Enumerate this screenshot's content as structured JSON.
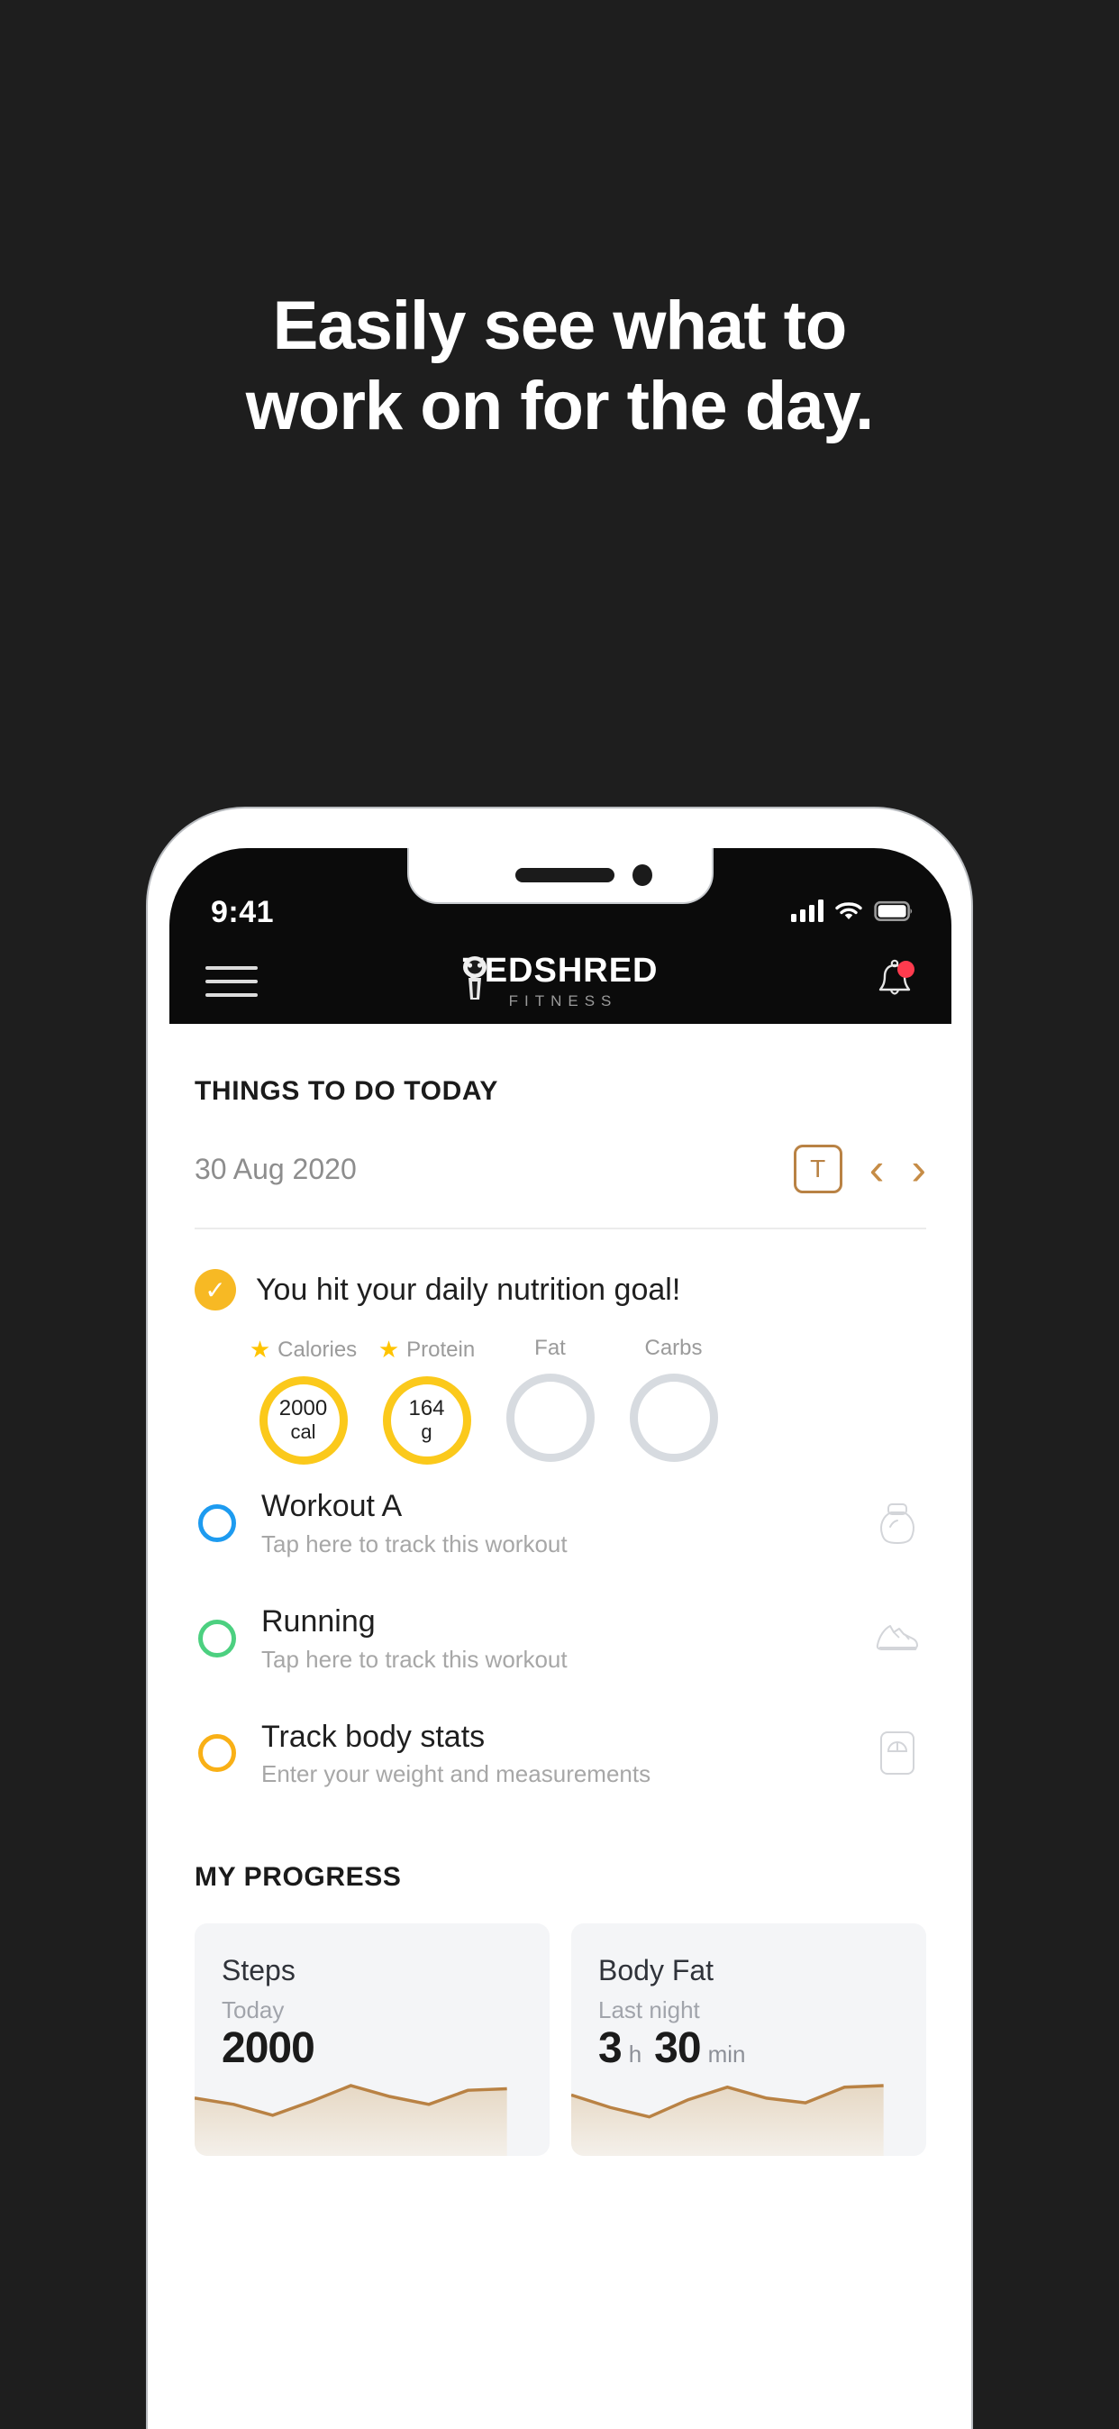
{
  "promo": {
    "line1": "Easily see what to",
    "line2": "work on for the day."
  },
  "status_bar": {
    "time": "9:41",
    "signal_icon": "cellular-signal-icon",
    "wifi_icon": "wifi-icon",
    "battery_icon": "battery-full-icon"
  },
  "app_bar": {
    "menu_icon": "hamburger-menu-icon",
    "brand_name": "TEDSHRED",
    "brand_tagline": "FITNESS",
    "mascot_icon": "mascot-logo-icon",
    "notifications_icon": "bell-icon",
    "notification_badge": true
  },
  "things_to_do": {
    "section_title": "THINGS TO DO TODAY",
    "date": "30 Aug 2020",
    "today_button_label": "T",
    "prev_icon": "chevron-left-icon",
    "next_icon": "chevron-right-icon"
  },
  "nutrition": {
    "check_icon": "checkmark-icon",
    "message": "You hit your daily nutrition goal!",
    "macros": [
      {
        "label": "Calories",
        "starred": true,
        "value": "2000",
        "unit": "cal",
        "complete": true
      },
      {
        "label": "Protein",
        "starred": true,
        "value": "164",
        "unit": "g",
        "complete": true
      },
      {
        "label": "Fat",
        "starred": false,
        "value": "",
        "unit": "",
        "complete": false
      },
      {
        "label": "Carbs",
        "starred": false,
        "value": "",
        "unit": "",
        "complete": false
      }
    ]
  },
  "tasks": [
    {
      "title": "Workout A",
      "subtitle": "Tap here to track this workout",
      "ring_color": "#1d9bf0",
      "icon": "kettlebell-icon"
    },
    {
      "title": "Running",
      "subtitle": "Tap here to track this workout",
      "ring_color": "#4cd080",
      "icon": "running-shoe-icon"
    },
    {
      "title": "Track body stats",
      "subtitle": "Enter your weight and measurements",
      "ring_color": "#f9b016",
      "icon": "weight-scale-icon"
    }
  ],
  "my_progress": {
    "section_title": "MY PROGRESS",
    "cards": [
      {
        "title": "Steps",
        "period": "Today",
        "value": "2000",
        "unit": "",
        "value2": "",
        "unit2": ""
      },
      {
        "title": "Body Fat",
        "period": "Last night",
        "value": "3",
        "unit": "h",
        "value2": "30",
        "unit2": "min"
      }
    ]
  },
  "chart_data": [
    {
      "type": "area",
      "title": "Steps",
      "x": [
        0,
        1,
        2,
        3,
        4,
        5,
        6,
        7,
        8
      ],
      "values": [
        62,
        56,
        44,
        58,
        74,
        64,
        58,
        70,
        72
      ],
      "ylim": [
        0,
        100
      ],
      "xlabel": "",
      "ylabel": "",
      "grid": false,
      "legend": "none",
      "line_color": "#b98244",
      "fill_color": "#ece3d6"
    },
    {
      "type": "area",
      "title": "Body Fat",
      "x": [
        0,
        1,
        2,
        3,
        4,
        5,
        6,
        7,
        8
      ],
      "values": [
        64,
        52,
        42,
        60,
        72,
        62,
        56,
        72,
        74
      ],
      "ylim": [
        0,
        100
      ],
      "xlabel": "",
      "ylabel": "",
      "grid": false,
      "legend": "none",
      "line_color": "#b98244",
      "fill_color": "#ece3d6"
    }
  ],
  "colors": {
    "background": "#1e1e1e",
    "accent_gold": "#b98244",
    "nutrition_yellow": "#fbc91b",
    "badge_red": "#ff3b4e",
    "blue": "#1d9bf0",
    "green": "#4cd080",
    "amber": "#f9b016"
  }
}
